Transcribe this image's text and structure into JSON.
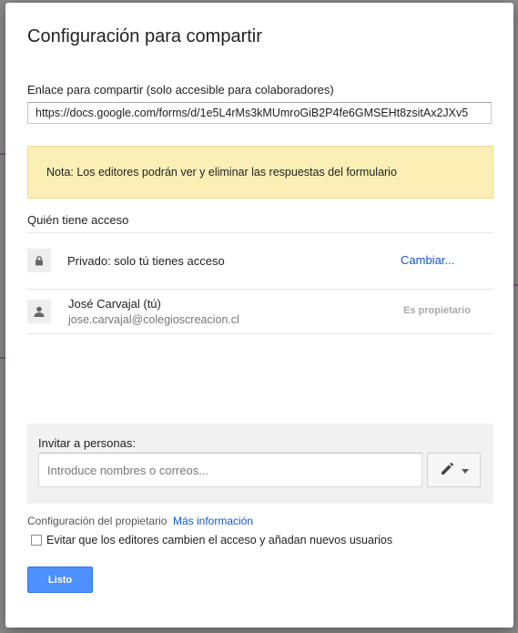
{
  "dialog": {
    "title": "Configuración para compartir",
    "link_label": "Enlace para compartir (solo accesible para colaboradores)",
    "link_value": "https://docs.google.com/forms/d/1e5L4rMs3kMUmroGiB2P4fe6GMSEHt8zsitAx2JXv5",
    "note": "Nota: Los editores podrán ver y eliminar las respuestas del formulario",
    "access_title": "Quién tiene acceso",
    "privacy": {
      "icon": "lock-icon",
      "label": "Privado: solo tú tienes acceso",
      "change_label": "Cambiar..."
    },
    "owner": {
      "icon": "person-icon",
      "name": "José Carvajal (tú)",
      "email": "jose.carvajal@colegioscreacion.cl",
      "role": "Es propietario"
    },
    "invite": {
      "label": "Invitar a personas:",
      "placeholder": "Introduce nombres o correos...",
      "permission_icon": "pencil-icon"
    },
    "owner_settings": {
      "label": "Configuración del propietario",
      "more_info": "Más información",
      "checkbox_label": "Evitar que los editores cambien el acceso y añadan nuevos usuarios",
      "checked": false
    },
    "done_label": "Listo"
  },
  "colors": {
    "accent": "#4d90fe",
    "link": "#1155cc",
    "note_bg": "#fcefb5"
  }
}
